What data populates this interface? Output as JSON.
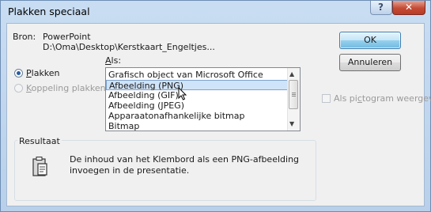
{
  "window": {
    "title": "Plakken speciaal",
    "help_label": "?",
    "close_label": "✕"
  },
  "source": {
    "label": "Bron:",
    "app": "PowerPoint",
    "path": "D:\\Oma\\Desktop\\Kerstkaart_Engeltjes..."
  },
  "as_label": "Als:",
  "paste_options": [
    {
      "label": "Plakken",
      "selected": true,
      "enabled": true
    },
    {
      "label": "Koppeling plakken",
      "selected": false,
      "enabled": false
    }
  ],
  "formats": [
    {
      "label": "Grafisch object van Microsoft Office",
      "selected": false
    },
    {
      "label": "Afbeelding (PNG)",
      "selected": true
    },
    {
      "label": "Afbeelding (GIF)",
      "selected": false
    },
    {
      "label": "Afbeelding (JPEG)",
      "selected": false
    },
    {
      "label": "Apparaatonafhankelijke bitmap",
      "selected": false
    },
    {
      "label": "Bitmap",
      "selected": false
    }
  ],
  "buttons": {
    "ok": "OK",
    "cancel": "Annuleren"
  },
  "icon_checkbox": {
    "label": "Als pictogram weergeven",
    "checked": false,
    "enabled": false
  },
  "result": {
    "title": "Resultaat",
    "text_line1": "De inhoud van het Klembord als een PNG-afbeelding",
    "text_line2": "invoegen in de presentatie."
  },
  "colors": {
    "titlebar": "#c9ddf2",
    "selection": "#cfe3f9",
    "default_button": "#98d1ef",
    "close_button": "#c44b35"
  }
}
